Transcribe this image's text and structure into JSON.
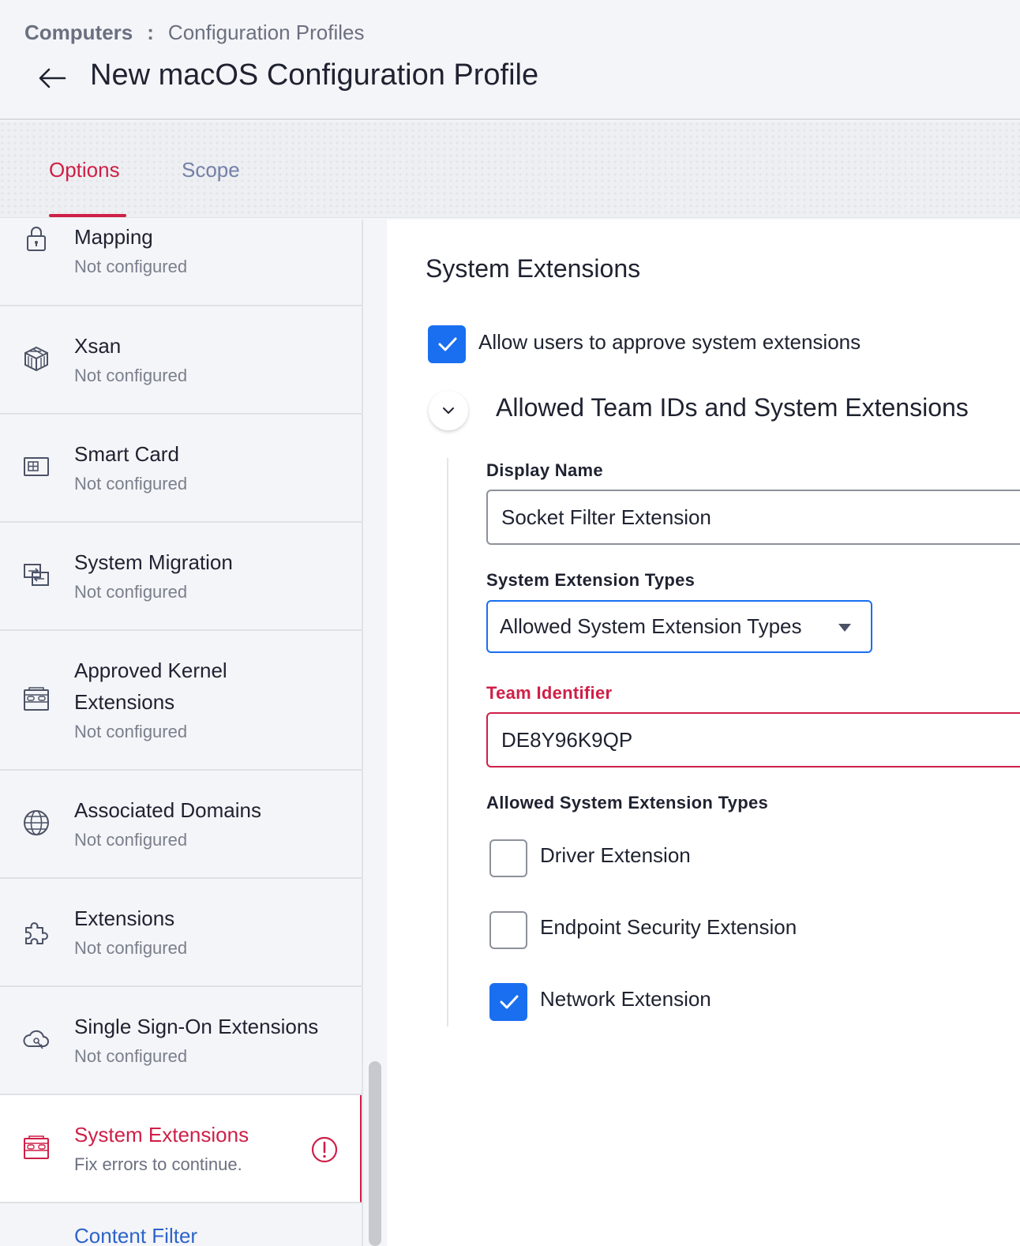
{
  "header": {
    "breadcrumb_root": "Computers",
    "breadcrumb_separator": ":",
    "breadcrumb_current": "Configuration Profiles",
    "title": "New macOS Configuration Profile"
  },
  "tabs": {
    "options": "Options",
    "scope": "Scope"
  },
  "sidebar": {
    "items": [
      {
        "title": "Mapping",
        "subtitle": "Not configured",
        "icon": "lock-icon"
      },
      {
        "title": "Xsan",
        "subtitle": "Not configured",
        "icon": "cube-icon"
      },
      {
        "title": "Smart Card",
        "subtitle": "Not configured",
        "icon": "smart-card-icon"
      },
      {
        "title": "System Migration",
        "subtitle": "Not configured",
        "icon": "migration-icon"
      },
      {
        "title": "Approved Kernel",
        "title_line2": "Extensions",
        "subtitle": "Not configured",
        "icon": "kernel-extension-icon"
      },
      {
        "title": "Associated Domains",
        "subtitle": "Not configured",
        "icon": "globe-icon"
      },
      {
        "title": "Extensions",
        "subtitle": "Not configured",
        "icon": "puzzle-icon"
      },
      {
        "title": "Single Sign-On Extensions",
        "subtitle": "Not configured",
        "icon": "cloud-key-icon"
      },
      {
        "title": "System Extensions",
        "subtitle": "Fix errors to continue.",
        "icon": "system-extension-icon",
        "status": "error"
      }
    ],
    "partial_item": "Content Filter"
  },
  "main": {
    "section_title": "System Extensions",
    "allow_users_label": "Allow users to approve system extensions",
    "allow_users_checked": true,
    "subsection_title": "Allowed Team IDs and System Extensions",
    "display_name_label": "Display Name",
    "display_name_value": "Socket Filter Extension",
    "types_label": "System Extension Types",
    "types_select_value": "Allowed System Extension Types",
    "team_id_label": "Team Identifier",
    "team_id_value": "DE8Y96K9QP",
    "allowed_types_label": "Allowed System Extension Types",
    "allowed_types": [
      {
        "label": "Driver Extension",
        "checked": false
      },
      {
        "label": "Endpoint Security Extension",
        "checked": false
      },
      {
        "label": "Network Extension",
        "checked": true
      }
    ]
  },
  "colors": {
    "accent_red": "#cf1f47",
    "accent_blue": "#1a6ff0",
    "link_blue": "#2d63c8"
  }
}
